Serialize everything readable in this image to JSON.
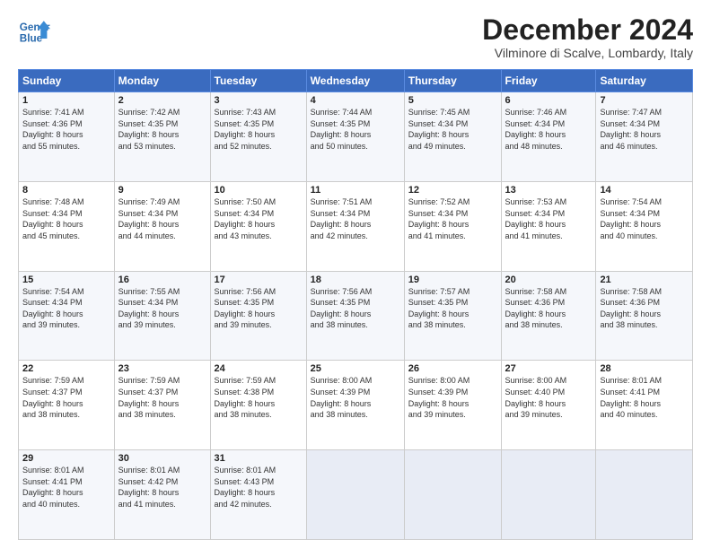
{
  "header": {
    "logo_general": "General",
    "logo_blue": "Blue",
    "month_title": "December 2024",
    "location": "Vilminore di Scalve, Lombardy, Italy"
  },
  "weekdays": [
    "Sunday",
    "Monday",
    "Tuesday",
    "Wednesday",
    "Thursday",
    "Friday",
    "Saturday"
  ],
  "weeks": [
    [
      {
        "day": "1",
        "info": "Sunrise: 7:41 AM\nSunset: 4:36 PM\nDaylight: 8 hours\nand 55 minutes."
      },
      {
        "day": "2",
        "info": "Sunrise: 7:42 AM\nSunset: 4:35 PM\nDaylight: 8 hours\nand 53 minutes."
      },
      {
        "day": "3",
        "info": "Sunrise: 7:43 AM\nSunset: 4:35 PM\nDaylight: 8 hours\nand 52 minutes."
      },
      {
        "day": "4",
        "info": "Sunrise: 7:44 AM\nSunset: 4:35 PM\nDaylight: 8 hours\nand 50 minutes."
      },
      {
        "day": "5",
        "info": "Sunrise: 7:45 AM\nSunset: 4:34 PM\nDaylight: 8 hours\nand 49 minutes."
      },
      {
        "day": "6",
        "info": "Sunrise: 7:46 AM\nSunset: 4:34 PM\nDaylight: 8 hours\nand 48 minutes."
      },
      {
        "day": "7",
        "info": "Sunrise: 7:47 AM\nSunset: 4:34 PM\nDaylight: 8 hours\nand 46 minutes."
      }
    ],
    [
      {
        "day": "8",
        "info": "Sunrise: 7:48 AM\nSunset: 4:34 PM\nDaylight: 8 hours\nand 45 minutes."
      },
      {
        "day": "9",
        "info": "Sunrise: 7:49 AM\nSunset: 4:34 PM\nDaylight: 8 hours\nand 44 minutes."
      },
      {
        "day": "10",
        "info": "Sunrise: 7:50 AM\nSunset: 4:34 PM\nDaylight: 8 hours\nand 43 minutes."
      },
      {
        "day": "11",
        "info": "Sunrise: 7:51 AM\nSunset: 4:34 PM\nDaylight: 8 hours\nand 42 minutes."
      },
      {
        "day": "12",
        "info": "Sunrise: 7:52 AM\nSunset: 4:34 PM\nDaylight: 8 hours\nand 41 minutes."
      },
      {
        "day": "13",
        "info": "Sunrise: 7:53 AM\nSunset: 4:34 PM\nDaylight: 8 hours\nand 41 minutes."
      },
      {
        "day": "14",
        "info": "Sunrise: 7:54 AM\nSunset: 4:34 PM\nDaylight: 8 hours\nand 40 minutes."
      }
    ],
    [
      {
        "day": "15",
        "info": "Sunrise: 7:54 AM\nSunset: 4:34 PM\nDaylight: 8 hours\nand 39 minutes."
      },
      {
        "day": "16",
        "info": "Sunrise: 7:55 AM\nSunset: 4:34 PM\nDaylight: 8 hours\nand 39 minutes."
      },
      {
        "day": "17",
        "info": "Sunrise: 7:56 AM\nSunset: 4:35 PM\nDaylight: 8 hours\nand 39 minutes."
      },
      {
        "day": "18",
        "info": "Sunrise: 7:56 AM\nSunset: 4:35 PM\nDaylight: 8 hours\nand 38 minutes."
      },
      {
        "day": "19",
        "info": "Sunrise: 7:57 AM\nSunset: 4:35 PM\nDaylight: 8 hours\nand 38 minutes."
      },
      {
        "day": "20",
        "info": "Sunrise: 7:58 AM\nSunset: 4:36 PM\nDaylight: 8 hours\nand 38 minutes."
      },
      {
        "day": "21",
        "info": "Sunrise: 7:58 AM\nSunset: 4:36 PM\nDaylight: 8 hours\nand 38 minutes."
      }
    ],
    [
      {
        "day": "22",
        "info": "Sunrise: 7:59 AM\nSunset: 4:37 PM\nDaylight: 8 hours\nand 38 minutes."
      },
      {
        "day": "23",
        "info": "Sunrise: 7:59 AM\nSunset: 4:37 PM\nDaylight: 8 hours\nand 38 minutes."
      },
      {
        "day": "24",
        "info": "Sunrise: 7:59 AM\nSunset: 4:38 PM\nDaylight: 8 hours\nand 38 minutes."
      },
      {
        "day": "25",
        "info": "Sunrise: 8:00 AM\nSunset: 4:39 PM\nDaylight: 8 hours\nand 38 minutes."
      },
      {
        "day": "26",
        "info": "Sunrise: 8:00 AM\nSunset: 4:39 PM\nDaylight: 8 hours\nand 39 minutes."
      },
      {
        "day": "27",
        "info": "Sunrise: 8:00 AM\nSunset: 4:40 PM\nDaylight: 8 hours\nand 39 minutes."
      },
      {
        "day": "28",
        "info": "Sunrise: 8:01 AM\nSunset: 4:41 PM\nDaylight: 8 hours\nand 40 minutes."
      }
    ],
    [
      {
        "day": "29",
        "info": "Sunrise: 8:01 AM\nSunset: 4:41 PM\nDaylight: 8 hours\nand 40 minutes."
      },
      {
        "day": "30",
        "info": "Sunrise: 8:01 AM\nSunset: 4:42 PM\nDaylight: 8 hours\nand 41 minutes."
      },
      {
        "day": "31",
        "info": "Sunrise: 8:01 AM\nSunset: 4:43 PM\nDaylight: 8 hours\nand 42 minutes."
      },
      null,
      null,
      null,
      null
    ]
  ]
}
